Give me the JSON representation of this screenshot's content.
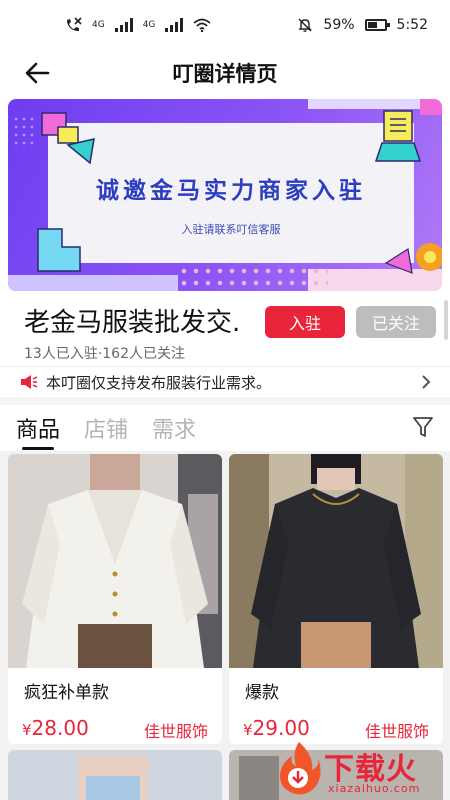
{
  "status_bar": {
    "network_a": "4G",
    "network_b": "4G",
    "battery_percent": "59%",
    "battery_level": 0.59,
    "time": "5:52",
    "icons": [
      "call-forwarding-icon",
      "signal-icon",
      "signal-icon",
      "wifi-icon",
      "mute-icon",
      "battery-icon"
    ]
  },
  "nav": {
    "title": "叮圈详情页",
    "back_icon": "arrow-left-icon"
  },
  "banner": {
    "title": "诚邀金马实力商家入驻",
    "subtitle": "入驻请联系叮信客服",
    "background_color": "#7b47f4",
    "title_color": "#2c3dbf"
  },
  "group": {
    "name": "老金马服装批发交.",
    "join_label": "入驻",
    "follow_label": "已关注",
    "stats": "13人已入驻·162人已关注"
  },
  "notice": {
    "icon": "speaker-icon",
    "text": "本叮圈仅支持发布服装行业需求。",
    "arrow_icon": "chevron-right-icon"
  },
  "tabs": [
    {
      "label": "商品",
      "active": true
    },
    {
      "label": "店铺",
      "active": false
    },
    {
      "label": "需求",
      "active": false
    }
  ],
  "filter_icon": "filter-icon",
  "products": [
    {
      "title": "疯狂补单款",
      "currency": "¥",
      "price": "28.00",
      "shop": "佳世服饰"
    },
    {
      "title": "爆款",
      "currency": "¥",
      "price": "29.00",
      "shop": "佳世服饰"
    }
  ],
  "watermark": {
    "text": "下载火",
    "url": "xiazaihuo.com"
  },
  "colors": {
    "accent": "#e8253a",
    "follow_button": "#bdbdbd",
    "inactive_tab": "#b4b4b4"
  }
}
